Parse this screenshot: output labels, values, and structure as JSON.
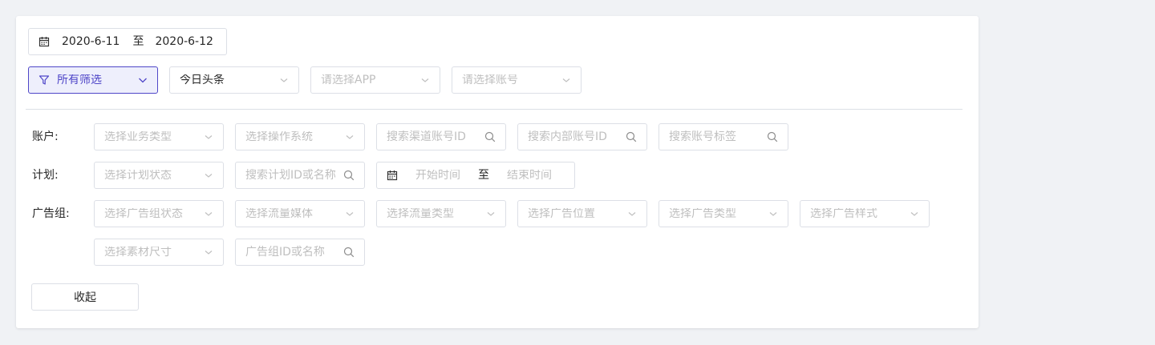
{
  "date_range": {
    "start": "2020-6-11",
    "separator": "至",
    "end": "2020-6-12",
    "icon": "calendar-icon"
  },
  "toolbar": {
    "filter_label": "所有筛选",
    "media_value": "今日头条",
    "app_placeholder": "请选择APP",
    "account_placeholder": "请选择账号"
  },
  "account_row": {
    "label": "账户:",
    "business_type": "选择业务类型",
    "os": "选择操作系统",
    "channel_account_search": "搜索渠道账号ID",
    "internal_account_search": "搜索内部账号ID",
    "account_tag_search": "搜索账号标签"
  },
  "plan_row": {
    "label": "计划:",
    "plan_status": "选择计划状态",
    "plan_search": "搜索计划ID或名称",
    "time_start": "开始时间",
    "time_separator": "至",
    "time_end": "结束时间"
  },
  "adgroup_row": {
    "label": "广告组:",
    "adgroup_status": "选择广告组状态",
    "traffic_media": "选择流量媒体",
    "traffic_type": "选择流量类型",
    "ad_position": "选择广告位置",
    "ad_type": "选择广告类型",
    "ad_style": "选择广告样式",
    "material_size": "选择素材尺寸",
    "adgroup_search": "广告组ID或名称"
  },
  "collapse_label": "收起",
  "colors": {
    "accent": "#4f46c8",
    "accent_bg": "#eeeffc",
    "border": "#dcdfe6",
    "placeholder": "#bfbfbf",
    "page_bg": "#f0f2f5"
  }
}
